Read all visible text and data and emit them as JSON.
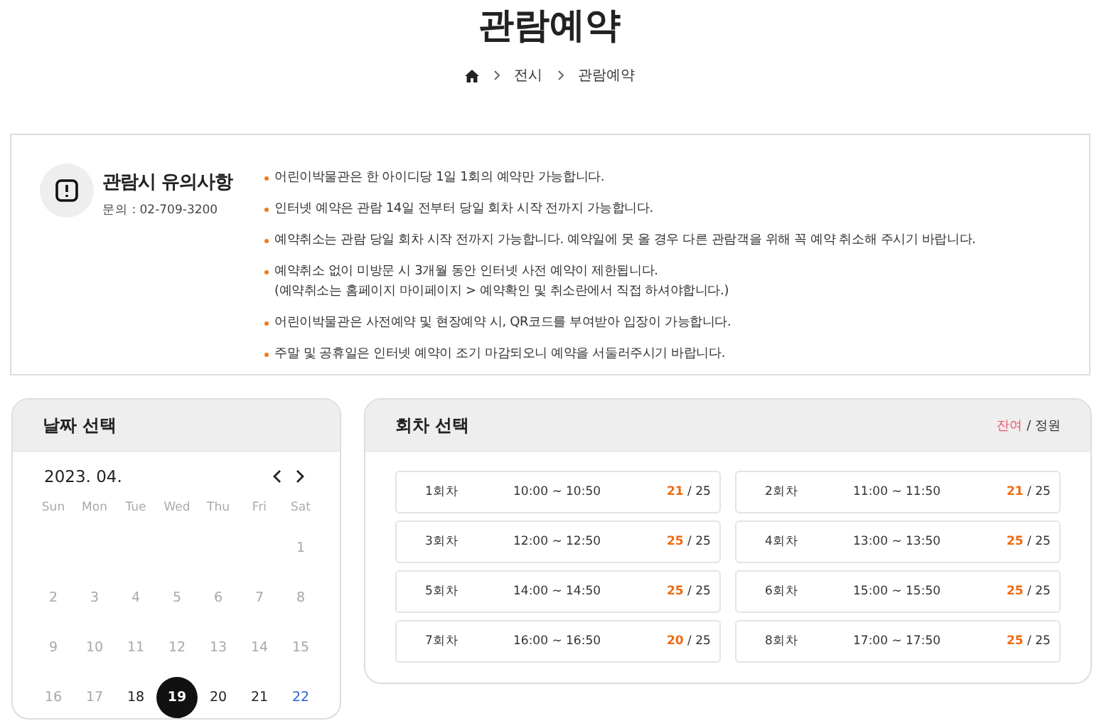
{
  "page_title": "관람예약",
  "breadcrumb": [
    "전시",
    "관람예약"
  ],
  "notice": {
    "title": "관람시 유의사항",
    "contact": "문의 : 02-709-3200",
    "items": [
      [
        "어린이박물관은 한 아이디당 1일 1회의 예약만 가능합니다."
      ],
      [
        "인터넷 예약은 관람 14일 전부터 당일 회차 시작 전까지 가능합니다."
      ],
      [
        "예약취소는 관람 당일 회차 시작 전까지 가능합니다. 예약일에 못 올 경우 다른 관람객을 위해 꼭 예약 취소해 주시기 바랍니다."
      ],
      [
        "예약취소 없이 미방문 시 3개월 동안 인터넷 사전 예약이 제한됩니다.",
        "(예약취소는 홈페이지 마이페이지 > 예약확인 및 취소란에서 직접 하셔야합니다.)"
      ],
      [
        "어린이박물관은 사전예약 및 현장예약 시, QR코드를 부여받아 입장이 가능합니다."
      ],
      [
        "주말 및 공휴일은 인터넷 예약이 조기 마감되오니 예약을 서둘러주시기 바랍니다."
      ]
    ]
  },
  "calendar": {
    "title": "날짜 선택",
    "month": "2023. 04.",
    "weekdays": [
      "Sun",
      "Mon",
      "Tue",
      "Wed",
      "Thu",
      "Fri",
      "Sat"
    ],
    "weeks": [
      [
        {
          "day": "1",
          "disabled": true,
          "selected": false
        }
      ],
      [
        {
          "day": "2",
          "disabled": true,
          "selected": false
        },
        {
          "day": "3",
          "disabled": true,
          "selected": false
        },
        {
          "day": "4",
          "disabled": true,
          "selected": false
        },
        {
          "day": "5",
          "disabled": true,
          "selected": false
        },
        {
          "day": "6",
          "disabled": true,
          "selected": false
        },
        {
          "day": "7",
          "disabled": true,
          "selected": false
        },
        {
          "day": "8",
          "disabled": true,
          "selected": false
        }
      ],
      [
        {
          "day": "9",
          "disabled": true,
          "selected": false
        },
        {
          "day": "10",
          "disabled": true,
          "selected": false
        },
        {
          "day": "11",
          "disabled": true,
          "selected": false
        },
        {
          "day": "12",
          "disabled": true,
          "selected": false
        },
        {
          "day": "13",
          "disabled": true,
          "selected": false
        },
        {
          "day": "14",
          "disabled": true,
          "selected": false
        },
        {
          "day": "15",
          "disabled": true,
          "selected": false
        }
      ],
      [
        {
          "day": "16",
          "disabled": true,
          "selected": false
        },
        {
          "day": "17",
          "disabled": true,
          "selected": false
        },
        {
          "day": "18",
          "disabled": false,
          "selected": false
        },
        {
          "day": "19",
          "disabled": false,
          "selected": true
        },
        {
          "day": "20",
          "disabled": false,
          "selected": false
        },
        {
          "day": "21",
          "disabled": false,
          "selected": false
        },
        {
          "day": "22",
          "disabled": false,
          "selected": false
        }
      ]
    ]
  },
  "sessions": {
    "title": "회차 선택",
    "legend_remaining": "잔여",
    "legend_sep": "/ 정원",
    "items": [
      {
        "name": "1회차",
        "time": "10:00 ~ 10:50",
        "remaining": "21",
        "capacity": "/ 25"
      },
      {
        "name": "2회차",
        "time": "11:00 ~ 11:50",
        "remaining": "21",
        "capacity": "/ 25"
      },
      {
        "name": "3회차",
        "time": "12:00 ~ 12:50",
        "remaining": "25",
        "capacity": "/ 25"
      },
      {
        "name": "4회차",
        "time": "13:00 ~ 13:50",
        "remaining": "25",
        "capacity": "/ 25"
      },
      {
        "name": "5회차",
        "time": "14:00 ~ 14:50",
        "remaining": "25",
        "capacity": "/ 25"
      },
      {
        "name": "6회차",
        "time": "15:00 ~ 15:50",
        "remaining": "25",
        "capacity": "/ 25"
      },
      {
        "name": "7회차",
        "time": "16:00 ~ 16:50",
        "remaining": "20",
        "capacity": "/ 25"
      },
      {
        "name": "8회차",
        "time": "17:00 ~ 17:50",
        "remaining": "25",
        "capacity": "/ 25"
      }
    ]
  }
}
